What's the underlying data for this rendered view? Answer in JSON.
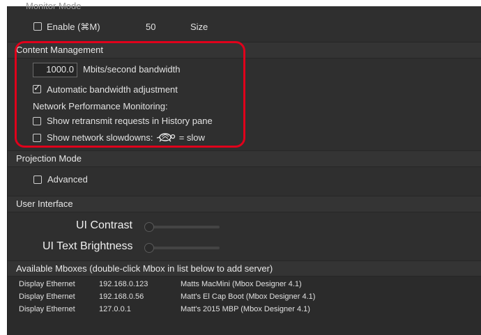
{
  "monitor": {
    "title": "Monitor Mode",
    "enable_label": "Enable (⌘M)",
    "size_value": "50",
    "size_label": "Size"
  },
  "content_management": {
    "header": "Content Management",
    "bandwidth_value": "1000.0",
    "bandwidth_label": "Mbits/second bandwidth",
    "auto_adjust_label": "Automatic bandwidth adjustment",
    "auto_adjust_checked": true,
    "npm_label": "Network Performance Monitoring:",
    "retransmit_label": "Show retransmit requests in History pane",
    "slowdowns_label": "Show network slowdowns:",
    "slow_suffix": "= slow",
    "highlight_color": "#e0001b"
  },
  "projection": {
    "header": "Projection Mode",
    "advanced_label": "Advanced"
  },
  "ui": {
    "header": "User Interface",
    "contrast_label": "UI Contrast",
    "brightness_label": "UI Text Brightness"
  },
  "mboxes": {
    "header": "Available Mboxes (double-click Mbox in list below to add server)",
    "rows": [
      {
        "type": "Display Ethernet",
        "ip": "192.168.0.123",
        "name": "Matts MacMini (Mbox Designer 4.1)"
      },
      {
        "type": "Display Ethernet",
        "ip": "192.168.0.56",
        "name": "Matt's El Cap Boot (Mbox Designer 4.1)"
      },
      {
        "type": "Display Ethernet",
        "ip": "127.0.0.1",
        "name": "Matt's 2015 MBP (Mbox Designer 4.1)"
      }
    ]
  },
  "icons": {
    "turtle": "turtle-icon"
  }
}
